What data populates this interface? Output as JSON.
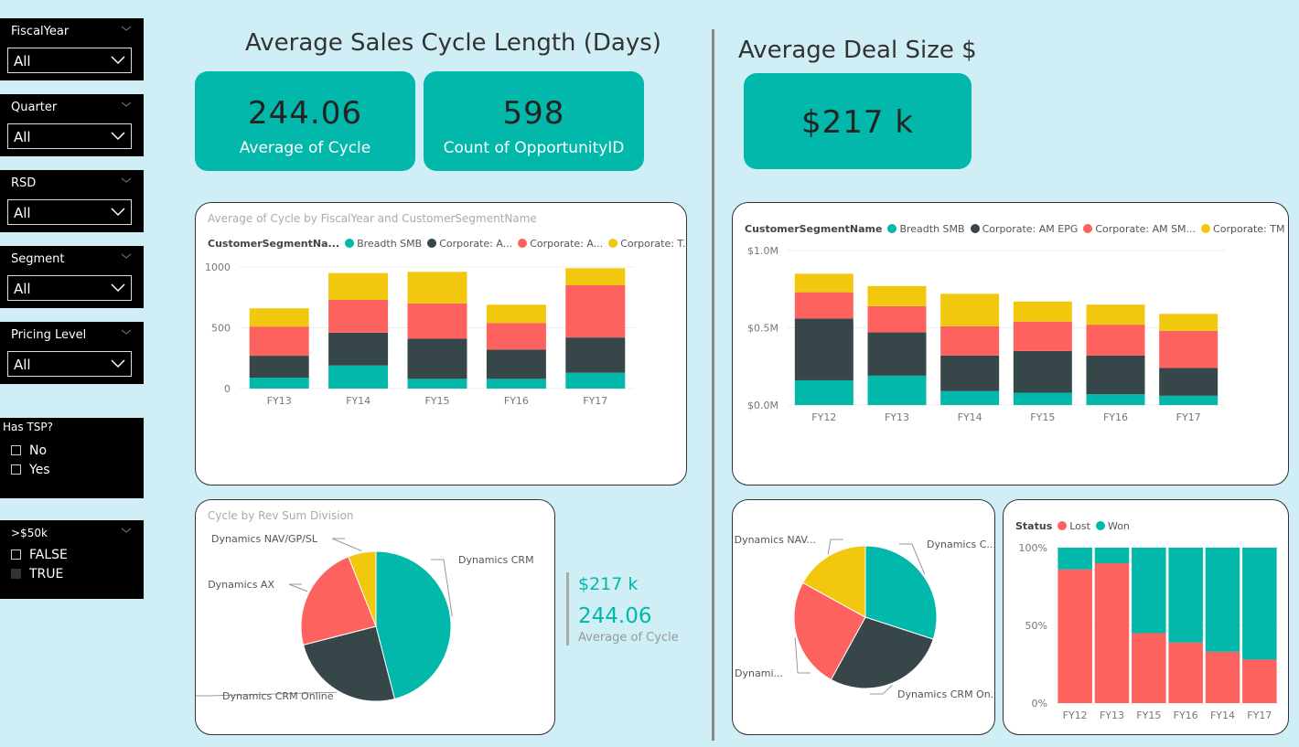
{
  "colors": {
    "teal": "#01b8aa",
    "dark": "#374649",
    "red": "#fd625e",
    "yellow": "#f2c80f",
    "lost": "#fd625e",
    "won": "#01b8aa"
  },
  "slicers": {
    "fiscal_year": {
      "title": "FiscalYear",
      "value": "All"
    },
    "quarter": {
      "title": "Quarter",
      "value": "All"
    },
    "rsd": {
      "title": "RSD",
      "value": "All"
    },
    "segment": {
      "title": "Segment",
      "value": "All"
    },
    "pricing_level": {
      "title": "Pricing Level",
      "value": "All"
    },
    "has_tsp": {
      "title": "Has TSP?",
      "options": [
        "No",
        "Yes"
      ]
    },
    "over_50k": {
      "title": ">$50k",
      "options": [
        "FALSE",
        "TRUE"
      ]
    }
  },
  "headers": {
    "cycle": "Average Sales Cycle Length (Days)",
    "deal": "Average Deal Size $"
  },
  "cards": {
    "avg_cycle": {
      "value": "244.06",
      "label": "Average of Cycle"
    },
    "count_opp": {
      "value": "598",
      "label": "Count of OpportunityID"
    },
    "deal_size": {
      "value": "$217 k"
    }
  },
  "kpi_side": {
    "deal": "$217 k",
    "cycle": "244.06",
    "label": "Average of Cycle"
  },
  "chart_data": [
    {
      "id": "cycle_by_year",
      "type": "bar",
      "title": "Average of Cycle by FiscalYear and CustomerSegmentName",
      "legend_title": "CustomerSegmentNa...",
      "legend_labels": [
        "Breadth SMB",
        "Corporate: A...",
        "Corporate: A...",
        "Corporate: T..."
      ],
      "categories": [
        "FY13",
        "FY14",
        "FY15",
        "FY16",
        "FY17"
      ],
      "series": [
        {
          "name": "Breadth SMB",
          "color": "#01b8aa",
          "values": [
            90,
            190,
            80,
            80,
            130
          ]
        },
        {
          "name": "Corporate: A...",
          "color": "#374649",
          "values": [
            180,
            270,
            330,
            240,
            290
          ]
        },
        {
          "name": "Corporate: A...",
          "color": "#fd625e",
          "values": [
            240,
            270,
            290,
            220,
            430
          ]
        },
        {
          "name": "Corporate: T...",
          "color": "#f2c80f",
          "values": [
            150,
            220,
            260,
            150,
            140
          ]
        }
      ],
      "ylim": [
        0,
        1000
      ],
      "yticks": [
        "1000",
        "500",
        "0"
      ],
      "stacked": true
    },
    {
      "id": "deal_by_year",
      "type": "bar",
      "legend_title": "CustomerSegmentName",
      "legend_labels": [
        "Breadth SMB",
        "Corporate: AM EPG",
        "Corporate: AM SM...",
        "Corporate: TM ..."
      ],
      "categories": [
        "FY12",
        "FY13",
        "FY14",
        "FY15",
        "FY16",
        "FY17"
      ],
      "series": [
        {
          "name": "Breadth SMB",
          "color": "#01b8aa",
          "values": [
            0.16,
            0.19,
            0.09,
            0.08,
            0.07,
            0.06
          ]
        },
        {
          "name": "Corporate: AM EPG",
          "color": "#374649",
          "values": [
            0.4,
            0.28,
            0.23,
            0.27,
            0.25,
            0.18
          ]
        },
        {
          "name": "Corporate: AM SM...",
          "color": "#fd625e",
          "values": [
            0.17,
            0.17,
            0.19,
            0.19,
            0.2,
            0.24
          ]
        },
        {
          "name": "Corporate: TM ...",
          "color": "#f2c80f",
          "values": [
            0.12,
            0.13,
            0.21,
            0.13,
            0.13,
            0.11
          ]
        }
      ],
      "ylim": [
        0,
        1.0
      ],
      "yticks": [
        "$1.0M",
        "$0.5M",
        "$0.0M"
      ],
      "stacked": true
    },
    {
      "id": "cycle_pie",
      "type": "pie",
      "title": "Cycle by Rev Sum Division",
      "slices": [
        {
          "label": "Dynamics CRM",
          "value": 46,
          "color": "#01b8aa"
        },
        {
          "label": "Dynamics CRM Online",
          "value": 25,
          "color": "#374649"
        },
        {
          "label": "Dynamics AX",
          "value": 23,
          "color": "#fd625e"
        },
        {
          "label": "Dynamics NAV/GP/SL",
          "value": 6,
          "color": "#f2c80f"
        }
      ]
    },
    {
      "id": "deal_pie",
      "type": "pie",
      "slices": [
        {
          "label": "Dynamics C...",
          "value": 30,
          "color": "#01b8aa"
        },
        {
          "label": "Dynamics CRM On...",
          "value": 28,
          "color": "#374649"
        },
        {
          "label": "Dynami...",
          "value": 25,
          "color": "#fd625e"
        },
        {
          "label": "Dynamics NAV...",
          "value": 17,
          "color": "#f2c80f"
        }
      ]
    },
    {
      "id": "status_bar",
      "type": "bar",
      "legend_title": "Status",
      "legend_labels": [
        "Lost",
        "Won"
      ],
      "categories": [
        "FY12",
        "FY13",
        "FY15",
        "FY16",
        "FY14",
        "FY17"
      ],
      "series": [
        {
          "name": "Lost",
          "color": "#fd625e",
          "values": [
            86,
            90,
            45,
            39,
            33,
            28
          ]
        },
        {
          "name": "Won",
          "color": "#01b8aa",
          "values": [
            14,
            10,
            55,
            61,
            67,
            72
          ]
        }
      ],
      "ylim": [
        0,
        100
      ],
      "yticks": [
        "100%",
        "50%",
        "0%"
      ],
      "stacked": true
    }
  ]
}
